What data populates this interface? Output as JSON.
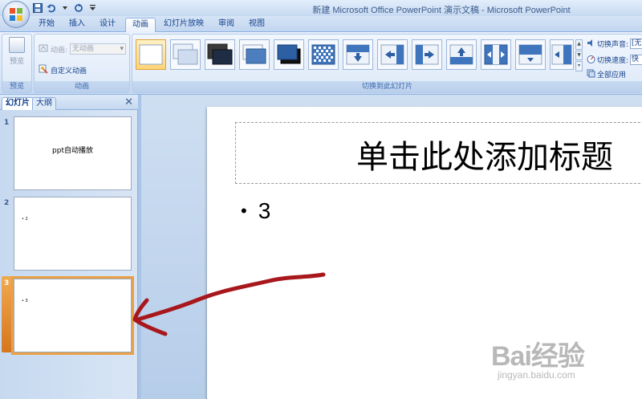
{
  "window": {
    "title": "新建 Microsoft Office PowerPoint 演示文稿 - Microsoft PowerPoint"
  },
  "tabs": [
    {
      "label": "开始"
    },
    {
      "label": "插入"
    },
    {
      "label": "设计"
    },
    {
      "label": "动画",
      "active": true
    },
    {
      "label": "幻灯片放映"
    },
    {
      "label": "审阅"
    },
    {
      "label": "视图"
    }
  ],
  "ribbon": {
    "preview_group": {
      "button_label": "预览",
      "group_label": "预览"
    },
    "animation_group": {
      "animation_label": "动画:",
      "animation_value": "无动画",
      "custom_animation_label": "自定义动画",
      "group_label": "动画"
    },
    "transition_group": {
      "group_label": "切换到此幻灯片",
      "sound_label": "切换声音:",
      "sound_value": "[无",
      "speed_label": "切换速度:",
      "speed_value": "快",
      "apply_all_label": "全部应用"
    }
  },
  "slides_pane": {
    "tab_slides": "幻灯片",
    "tab_outline": "大纲",
    "slides": [
      {
        "number": "1",
        "title": "ppt自动播放",
        "bullet": ""
      },
      {
        "number": "2",
        "title": "",
        "bullet": "• 2"
      },
      {
        "number": "3",
        "title": "",
        "bullet": "• 3",
        "selected": true
      }
    ]
  },
  "current_slide": {
    "title_placeholder": "单击此处添加标题",
    "bullet_text": "3"
  },
  "watermark": {
    "brand": "Bai经验",
    "url": "jingyan.baidu.com"
  },
  "colors": {
    "accent_selected": "#e9a148",
    "ribbon_text": "#15428b",
    "annotation_arrow": "#a8171c"
  }
}
